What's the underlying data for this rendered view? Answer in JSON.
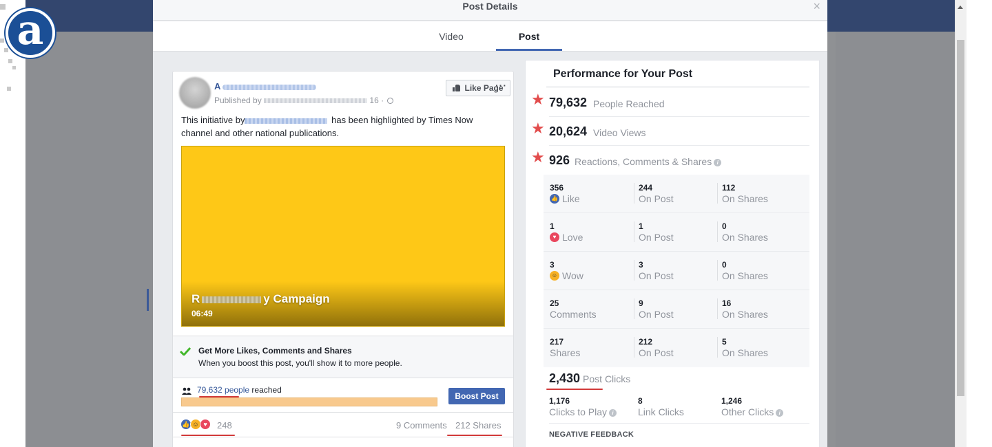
{
  "modal": {
    "title": "Post Details",
    "close": "×",
    "tabs": [
      "Video",
      "Post"
    ]
  },
  "post": {
    "page_name_initial": "A",
    "published_prefix": "Published by",
    "published_suffix": "16 ·",
    "like_page_label": "Like Page",
    "more": "···",
    "text_before": "This initiative by",
    "text_after": "has been highlighted by Times Now channel and other national publications.",
    "video": {
      "title_start": "R",
      "title_end": "y Campaign",
      "duration": "06:49",
      "color": "#fec817"
    },
    "boost": {
      "title": "Get More Likes, Comments and Shares",
      "subtitle": "When you boost this post, you'll show it to more people.",
      "button": "Boost Post"
    },
    "reach": {
      "link": "79,632 people",
      "suffix": "reached"
    },
    "reactions_count": "248",
    "comments": "9 Comments",
    "shares": "212 Shares"
  },
  "performance": {
    "title": "Performance for Your Post",
    "metrics": [
      {
        "value": "79,632",
        "label": "People Reached"
      },
      {
        "value": "20,624",
        "label": "Video Views"
      },
      {
        "value": "926",
        "label": "Reactions, Comments & Shares"
      }
    ],
    "rows": [
      {
        "total": "356",
        "total_label": "Like",
        "on_post": "244",
        "on_post_label": "On Post",
        "on_shares": "112",
        "on_shares_label": "On Shares"
      },
      {
        "total": "1",
        "total_label": "Love",
        "on_post": "1",
        "on_post_label": "On Post",
        "on_shares": "0",
        "on_shares_label": "On Shares"
      },
      {
        "total": "3",
        "total_label": "Wow",
        "on_post": "3",
        "on_post_label": "On Post",
        "on_shares": "0",
        "on_shares_label": "On Shares"
      },
      {
        "total": "25",
        "total_label": "Comments",
        "on_post": "9",
        "on_post_label": "On Post",
        "on_shares": "16",
        "on_shares_label": "On Shares"
      },
      {
        "total": "217",
        "total_label": "Shares",
        "on_post": "212",
        "on_post_label": "On Post",
        "on_shares": "5",
        "on_shares_label": "On Shares"
      }
    ],
    "post_clicks": {
      "value": "2,430",
      "label": "Post Clicks"
    },
    "click_breakdown": [
      {
        "value": "1,176",
        "label": "Clicks to Play"
      },
      {
        "value": "8",
        "label": "Link Clicks"
      },
      {
        "value": "1,246",
        "label": "Other Clicks"
      }
    ],
    "negative_feedback": "NEGATIVE FEEDBACK"
  },
  "colors": {
    "facebook_blue": "#4267b2",
    "link": "#365899",
    "star": "#e24c4c",
    "reach_bar": "#f8c98d"
  }
}
